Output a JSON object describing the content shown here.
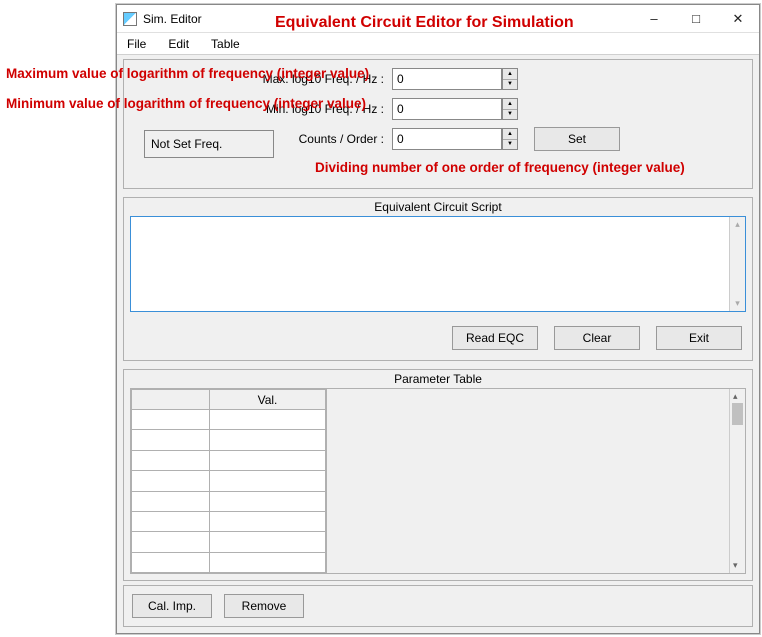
{
  "window": {
    "title": "Sim. Editor"
  },
  "menu": {
    "file": "File",
    "edit": "Edit",
    "table": "Table"
  },
  "annotations": {
    "mainTitle": "Equivalent Circuit Editor for Simulation",
    "maxLog": "Maximum value of logarithm of frequency (integer value)",
    "minLog": "Minimum value of logarithm of frequency (integer value)",
    "counts": "Dividing number of one order of frequency (integer value)"
  },
  "freq": {
    "maxLabel": "Max. log10 Freq. / Hz :",
    "maxValue": "0",
    "minLabel": "Min. log10 Freq. / Hz :",
    "minValue": "0",
    "countsLabel": "Counts / Order :",
    "countsValue": "0",
    "status": "Not Set Freq.",
    "setBtn": "Set"
  },
  "script": {
    "title": "Equivalent Circuit Script",
    "text": "",
    "readBtn": "Read EQC",
    "clearBtn": "Clear",
    "exitBtn": "Exit"
  },
  "paramTable": {
    "title": "Parameter Table",
    "colBlank": "",
    "colVal": "Val.",
    "rows": 8
  },
  "bottom": {
    "calBtn": "Cal. Imp.",
    "removeBtn": "Remove"
  }
}
